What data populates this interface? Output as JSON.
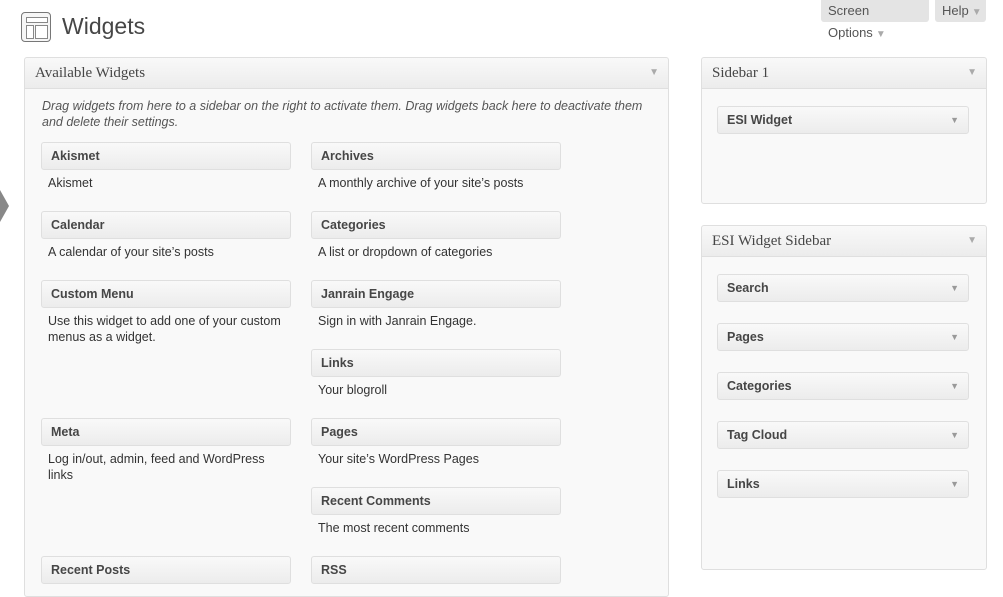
{
  "header": {
    "title": "Widgets",
    "screen_options": "Screen Options",
    "help": "Help"
  },
  "available": {
    "title": "Available Widgets",
    "description": "Drag widgets from here to a sidebar on the right to activate them. Drag widgets back here to deactivate them and delete their settings.",
    "widgets": [
      {
        "name": "Akismet",
        "desc": "Akismet"
      },
      {
        "name": "Archives",
        "desc": "A monthly archive of your site’s posts"
      },
      {
        "name": "Calendar",
        "desc": "A calendar of your site’s posts"
      },
      {
        "name": "Categories",
        "desc": "A list or dropdown of categories"
      },
      {
        "name": "Custom Menu",
        "desc": "Use this widget to add one of your custom menus as a widget."
      },
      {
        "name": "Janrain Engage",
        "desc": "Sign in with Janrain Engage."
      },
      {
        "name": "Links",
        "desc": "Your blogroll"
      },
      {
        "name": "Meta",
        "desc": "Log in/out, admin, feed and WordPress links"
      },
      {
        "name": "Pages",
        "desc": "Your site’s WordPress Pages"
      },
      {
        "name": "Recent Comments",
        "desc": "The most recent comments"
      },
      {
        "name": "Recent Posts",
        "desc": ""
      },
      {
        "name": "RSS",
        "desc": ""
      }
    ]
  },
  "sidebar1": {
    "title": "Sidebar 1",
    "widgets": [
      "ESI Widget"
    ]
  },
  "esi_sidebar": {
    "title": "ESI Widget Sidebar",
    "widgets": [
      "Search",
      "Pages",
      "Categories",
      "Tag Cloud",
      "Links"
    ]
  },
  "icons": {
    "collapse": "triangle-down-icon",
    "page": "widgets-page-icon"
  }
}
